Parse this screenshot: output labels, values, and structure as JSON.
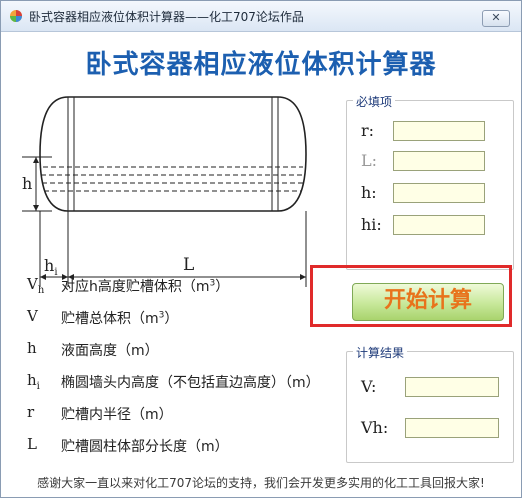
{
  "window": {
    "title": "卧式容器相应液位体积计算器——化工707论坛作品",
    "close_label": "✕"
  },
  "heading": "卧式容器相应液位体积计算器",
  "diagram": {
    "label_h": "h",
    "label_hi": "h",
    "label_hi_sub": "i",
    "label_L": "L"
  },
  "required_group": {
    "legend": "必填项",
    "fields": [
      {
        "label": "r:",
        "value": ""
      },
      {
        "label": "L:",
        "value": ""
      },
      {
        "label": "h:",
        "value": ""
      },
      {
        "label": "hi:",
        "value": ""
      }
    ]
  },
  "start_button": "开始计算",
  "result_group": {
    "legend": "计算结果",
    "fields": [
      {
        "label": "V:",
        "value": ""
      },
      {
        "label": "Vh:",
        "value": ""
      }
    ]
  },
  "definitions": [
    {
      "sym": "V",
      "sub": "h",
      "text": "对应h高度贮槽体积（m",
      "sup": "3",
      "tail": "）"
    },
    {
      "sym": "V",
      "sub": "",
      "text": "贮槽总体积（m",
      "sup": "3",
      "tail": "）"
    },
    {
      "sym": "h",
      "sub": "",
      "text": "液面高度（m）",
      "sup": "",
      "tail": ""
    },
    {
      "sym": "h",
      "sub": "i",
      "text": "椭圆墙头内高度（不包括直边高度）（m）",
      "sup": "",
      "tail": ""
    },
    {
      "sym": "r",
      "sub": "",
      "text": "贮槽内半径（m）",
      "sup": "",
      "tail": ""
    },
    {
      "sym": "L",
      "sub": "",
      "text": "贮槽圆柱体部分长度（m）",
      "sup": "",
      "tail": ""
    }
  ],
  "footer": "感谢大家一直以来对化工707论坛的支持，我们会开发更多实用的化工工具回报大家!",
  "colors": {
    "heading": "#1c5fb0",
    "button_text": "#e8731c",
    "button_face": "#c7e89a",
    "highlight": "#e02a2a",
    "input_bg": "#ffffe6"
  }
}
